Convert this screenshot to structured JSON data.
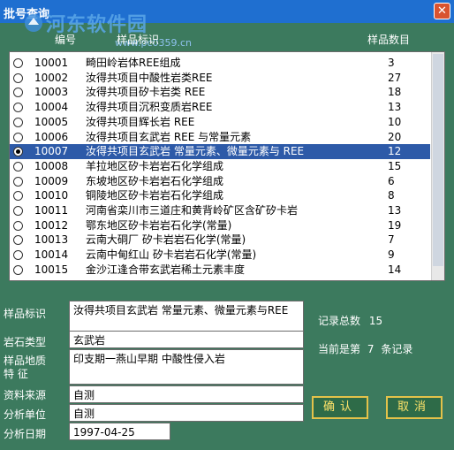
{
  "window": {
    "title": "批号查询"
  },
  "watermark": {
    "text": "河东软件园",
    "url": "www.pc0359.cn"
  },
  "table": {
    "headers": {
      "id": "编号",
      "desc": "样品标识",
      "count": "样品数目"
    },
    "rows": [
      {
        "id": "10001",
        "desc": "畸田岭岩体REE组成",
        "count": "3"
      },
      {
        "id": "10002",
        "desc": "汝得共项目中酸性岩类REE",
        "count": "27"
      },
      {
        "id": "10003",
        "desc": "汝得共项目矽卡岩类 REE",
        "count": "18"
      },
      {
        "id": "10004",
        "desc": "汝得共项目沉积变质岩REE",
        "count": "13"
      },
      {
        "id": "10005",
        "desc": "汝得共项目辉长岩 REE",
        "count": "10"
      },
      {
        "id": "10006",
        "desc": "汝得共项目玄武岩 REE 与常量元素",
        "count": "20"
      },
      {
        "id": "10007",
        "desc": "汝得共项目玄武岩 常量元素、微量元素与 REE",
        "count": "12",
        "selected": true
      },
      {
        "id": "10008",
        "desc": "羊拉地区矽卡岩岩石化学组成",
        "count": "15"
      },
      {
        "id": "10009",
        "desc": "东坡地区矽卡岩岩石化学组成",
        "count": "6"
      },
      {
        "id": "10010",
        "desc": "铜陵地区矽卡岩岩石化学组成",
        "count": "8"
      },
      {
        "id": "10011",
        "desc": "河南省栾川市三道庄和黄背岭矿区含矿矽卡岩",
        "count": "13"
      },
      {
        "id": "10012",
        "desc": "鄂东地区矽卡岩岩石化学(常量)",
        "count": "19"
      },
      {
        "id": "10013",
        "desc": "云南大硐厂 矽卡岩岩石化学(常量)",
        "count": "7"
      },
      {
        "id": "10014",
        "desc": "云南中甸红山 矽卡岩岩石化学(常量)",
        "count": "9"
      },
      {
        "id": "10015",
        "desc": "金沙江逢合带玄武岩稀土元素丰度",
        "count": "14"
      }
    ]
  },
  "form": {
    "sample_label": "样品标识",
    "sample_value": "汝得共项目玄武岩 常量元素、微量元素与REE",
    "rock_label": "岩石类型",
    "rock_value": "玄武岩",
    "geo_label_1": "样品地质",
    "geo_label_2": "特    征",
    "geo_value": "印支期一燕山早期 中酸性侵入岩",
    "source_label": "资料来源",
    "source_value": "自测",
    "unit_label": "分析单位",
    "unit_value": "自测",
    "date_label": "分析日期",
    "date_value": "1997-04-25"
  },
  "info": {
    "total_label": "记录总数",
    "total_value": "15",
    "current_prefix": "当前是第",
    "current_value": "7",
    "current_suffix": "条记录"
  },
  "buttons": {
    "ok": "确认",
    "cancel": "取消"
  }
}
